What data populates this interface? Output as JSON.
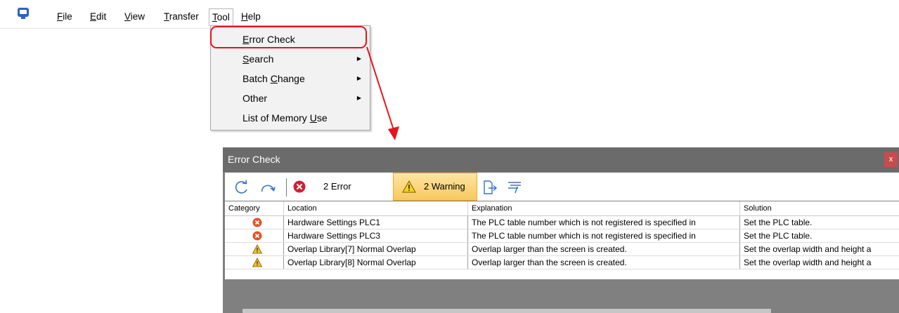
{
  "menubar": {
    "items": [
      {
        "pre": "",
        "ul": "F",
        "post": "ile"
      },
      {
        "pre": "",
        "ul": "E",
        "post": "dit"
      },
      {
        "pre": "",
        "ul": "V",
        "post": "iew"
      },
      {
        "pre": "",
        "ul": "T",
        "post": "ransfer"
      },
      {
        "pre": "",
        "ul": "T",
        "post": "ool"
      },
      {
        "pre": "",
        "ul": "H",
        "post": "elp"
      }
    ]
  },
  "tool_menu": {
    "items": [
      {
        "pre": "",
        "ul": "E",
        "post": "rror Check",
        "submenu": false
      },
      {
        "pre": "",
        "ul": "S",
        "post": "earch",
        "submenu": true
      },
      {
        "pre": "Batch ",
        "ul": "C",
        "post": "hange",
        "submenu": true
      },
      {
        "pre": "Other",
        "ul": "",
        "post": "",
        "submenu": true
      },
      {
        "pre": "List of Memory ",
        "ul": "U",
        "post": "se",
        "submenu": false
      }
    ]
  },
  "error_window": {
    "title": "Error Check",
    "close_label": "x",
    "error_count_label": "2 Error",
    "warning_count_label": "2 Warning",
    "columns": [
      "Category",
      "Location",
      "Explanation",
      "Solution"
    ],
    "rows": [
      {
        "category": "error",
        "location": "Hardware Settings PLC1",
        "explanation": "The PLC table number which is not registered is specified in",
        "solution": "Set the PLC table."
      },
      {
        "category": "error",
        "location": "Hardware Settings PLC3",
        "explanation": "The PLC table number which is not registered is specified in",
        "solution": "Set the PLC table."
      },
      {
        "category": "warning",
        "location": "Overlap Library[7] Normal Overlap",
        "explanation": "Overlap larger than the screen is created.",
        "solution": "Set the overlap width and height a"
      },
      {
        "category": "warning",
        "location": "Overlap Library[8] Normal Overlap",
        "explanation": "Overlap larger than the screen is created.",
        "solution": "Set the overlap width and height a"
      }
    ]
  },
  "colors": {
    "highlight": "#e8141d",
    "error_icon": "#e0542c",
    "warning_icon": "#f2c12e",
    "title_bar": "#6b6b6b"
  }
}
